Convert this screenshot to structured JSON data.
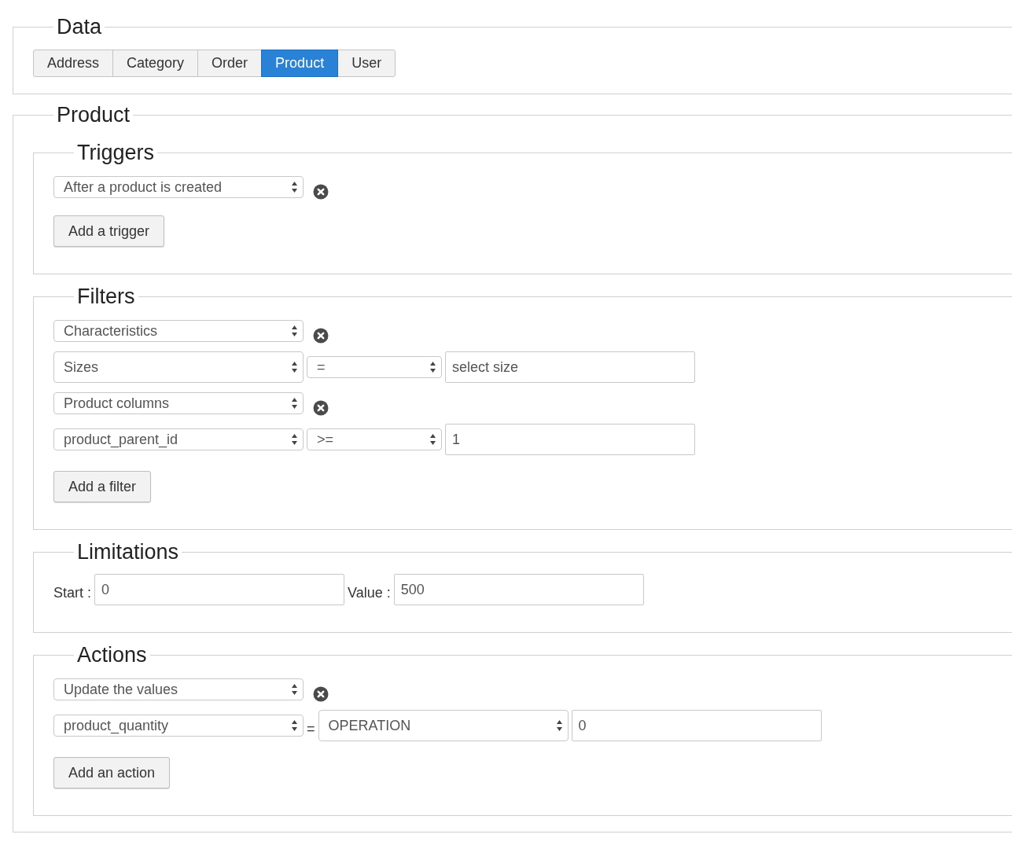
{
  "data": {
    "legend": "Data",
    "tabs": [
      {
        "label": "Address",
        "selected": false
      },
      {
        "label": "Category",
        "selected": false
      },
      {
        "label": "Order",
        "selected": false
      },
      {
        "label": "Product",
        "selected": true
      },
      {
        "label": "User",
        "selected": false
      }
    ]
  },
  "product": {
    "legend": "Product",
    "sections": [
      {
        "legend": "Triggers",
        "rows": [
          [
            {
              "kind": "select",
              "value": "After a product is created"
            },
            {
              "kind": "remove"
            }
          ]
        ],
        "button": "Add a trigger"
      },
      {
        "legend": "Filters",
        "rows": [
          [
            {
              "kind": "select",
              "value": "Characteristics"
            },
            {
              "kind": "remove"
            }
          ],
          [
            {
              "kind": "tall-select",
              "value": "Sizes"
            },
            {
              "kind": "operator-select",
              "value": "="
            },
            {
              "kind": "input",
              "value": "select size"
            }
          ],
          [
            {
              "kind": "select",
              "value": "Product columns"
            },
            {
              "kind": "remove"
            }
          ],
          [
            {
              "kind": "select",
              "value": "product_parent_id"
            },
            {
              "kind": "operator-select",
              "value": ">="
            },
            {
              "kind": "input",
              "value": "1"
            }
          ]
        ],
        "button": "Add a filter"
      },
      {
        "legend": "Limitations",
        "rows": [
          [
            {
              "kind": "label",
              "value": "Start :"
            },
            {
              "kind": "input",
              "value": "0"
            },
            {
              "kind": "label",
              "value": "Value :"
            },
            {
              "kind": "input",
              "value": "500"
            }
          ]
        ]
      },
      {
        "legend": "Actions",
        "rows": [
          [
            {
              "kind": "select",
              "value": "Update the values"
            },
            {
              "kind": "remove"
            }
          ],
          [
            {
              "kind": "select",
              "value": "product_quantity"
            },
            {
              "kind": "label",
              "value": "="
            },
            {
              "kind": "tall-select",
              "value": "OPERATION"
            },
            {
              "kind": "input",
              "value": "0"
            }
          ]
        ],
        "button": "Add an action"
      }
    ]
  }
}
